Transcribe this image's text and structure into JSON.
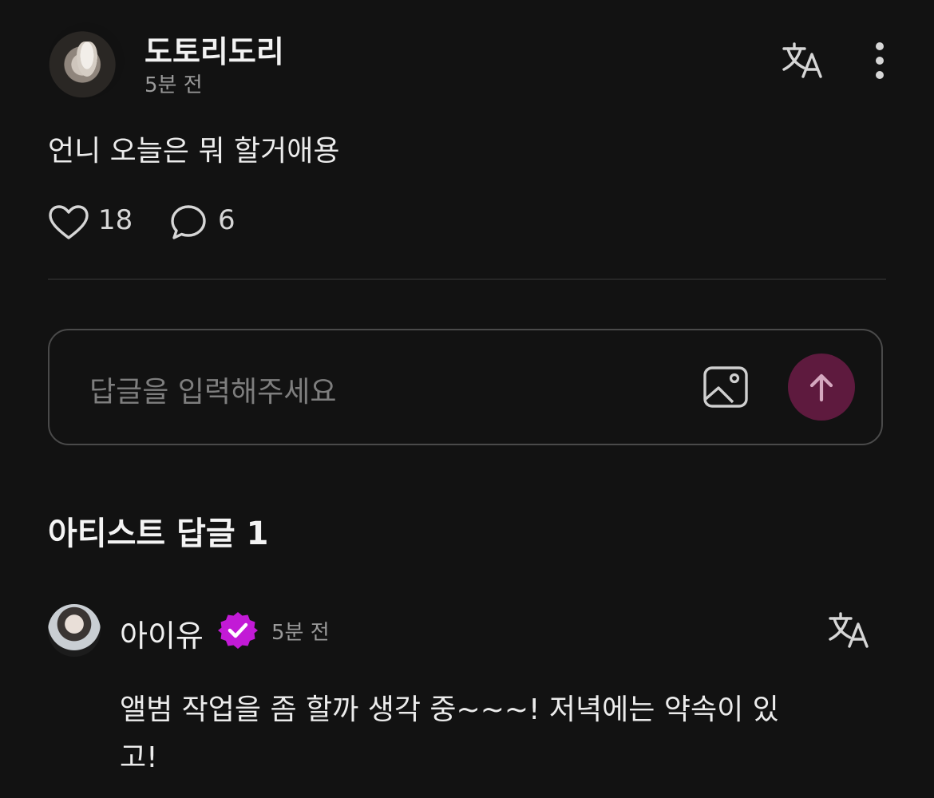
{
  "post": {
    "username": "도토리도리",
    "time": "5분 전",
    "body": "언니 오늘은 뭐 할거애용",
    "likes": "18",
    "comments": "6"
  },
  "reply_input": {
    "placeholder": "답글을 입력해주세요"
  },
  "section": {
    "title": "아티스트 답글 1"
  },
  "artist_reply": {
    "username": "아이유",
    "time": "5분 전",
    "body_line1": "앨범 작업을 좀 할까 생각 중~~~! 저녁에는 약속이 있",
    "body_line2": "고!"
  },
  "colors": {
    "background": "#121212",
    "send_button": "#5e1a3e",
    "verified_badge": "#c21ad6"
  },
  "icons": {
    "translate": "translate-icon",
    "more": "more-vertical-icon",
    "like": "heart-icon",
    "comment": "comment-icon",
    "image": "image-icon",
    "send": "arrow-up-icon",
    "verified": "verified-badge-icon"
  }
}
